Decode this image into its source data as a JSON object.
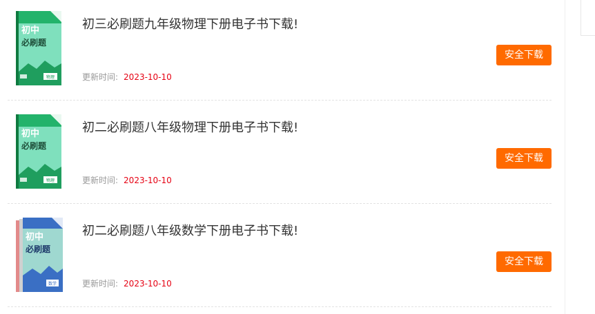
{
  "items": [
    {
      "title": "初三必刷题九年级物理下册电子书下载!",
      "meta_label": "更新时间:",
      "date": "2023-10-10",
      "button": "安全下载",
      "cover": {
        "variant": "green",
        "subject": "物理",
        "line1": "初中",
        "line2": "必刷题"
      }
    },
    {
      "title": "初二必刷题八年级物理下册电子书下载!",
      "meta_label": "更新时间:",
      "date": "2023-10-10",
      "button": "安全下载",
      "cover": {
        "variant": "green",
        "subject": "物理",
        "line1": "初中",
        "line2": "必刷题"
      }
    },
    {
      "title": "初二必刷题八年级数学下册电子书下载!",
      "meta_label": "更新时间:",
      "date": "2023-10-10",
      "button": "安全下载",
      "cover": {
        "variant": "blue",
        "subject": "数学",
        "line1": "初中",
        "line2": "必刷题"
      }
    }
  ],
  "colors": {
    "button": "#ff6a00",
    "date": "#e60012",
    "cover_green": "#23b36b",
    "cover_blue": "#3a6fc4"
  }
}
